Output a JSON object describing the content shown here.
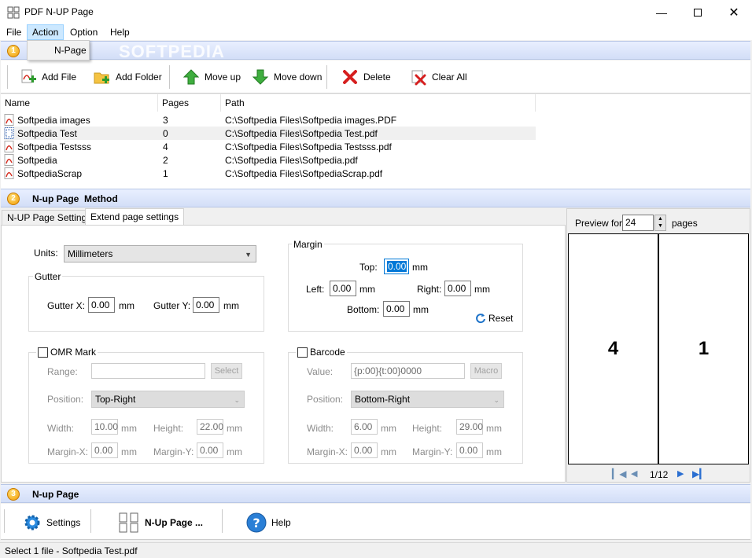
{
  "window": {
    "title": "PDF N-UP Page",
    "controls": [
      "minimize",
      "maximize",
      "close"
    ]
  },
  "menu": {
    "items": [
      "File",
      "Action",
      "Option",
      "Help"
    ],
    "active": "Action",
    "dropdown": [
      "N-Page"
    ]
  },
  "watermark": "SOFTPEDIA",
  "sections": [
    {
      "num": "1",
      "title": ""
    },
    {
      "num": "2",
      "title": "N-up Page  Method"
    },
    {
      "num": "3",
      "title": "N-up Page"
    }
  ],
  "toolbar": {
    "add_file": "Add File",
    "add_folder": "Add Folder",
    "move_up": "Move up",
    "move_down": "Move down",
    "delete": "Delete",
    "clear_all": "Clear All"
  },
  "filelist": {
    "columns": [
      "Name",
      "Pages",
      "Path"
    ],
    "rows": [
      {
        "name": "Softpedia images",
        "pages": "3",
        "path": "C:\\Softpedia Files\\Softpedia images.PDF"
      },
      {
        "name": "Softpedia Test",
        "pages": "0",
        "path": "C:\\Softpedia Files\\Softpedia Test.pdf"
      },
      {
        "name": "Softpedia Testsss",
        "pages": "4",
        "path": "C:\\Softpedia Files\\Softpedia Testsss.pdf"
      },
      {
        "name": "Softpedia",
        "pages": "2",
        "path": "C:\\Softpedia Files\\Softpedia.pdf"
      },
      {
        "name": "SoftpediaScrap",
        "pages": "1",
        "path": "C:\\Softpedia Files\\SoftpediaScrap.pdf"
      }
    ]
  },
  "tabs": [
    "N-UP Page Settings",
    "Extend page settings"
  ],
  "settings": {
    "units_label": "Units:",
    "units_value": "Millimeters",
    "gutter_title": "Gutter",
    "gutter_x_label": "Gutter X:",
    "gutter_x_value": "0.00",
    "gutter_y_label": "Gutter Y:",
    "gutter_y_value": "0.00",
    "mm": "mm",
    "margin_title": "Margin",
    "top_label": "Top:",
    "top_value": "0.00",
    "left_label": "Left:",
    "left_value": "0.00",
    "right_label": "Right:",
    "right_value": "0.00",
    "bottom_label": "Bottom:",
    "bottom_value": "0.00",
    "reset": "Reset",
    "omr_label": "OMR Mark",
    "omr_range_label": "Range:",
    "omr_select": "Select",
    "omr_position_label": "Position:",
    "omr_position_value": "Top-Right",
    "omr_width_label": "Width:",
    "omr_width_value": "10.00",
    "omr_height_label": "Height:",
    "omr_height_value": "22.00",
    "omr_marginx_label": "Margin-X:",
    "omr_marginx_value": "0.00",
    "omr_marginy_label": "Margin-Y:",
    "omr_marginy_value": "0.00",
    "barcode_label": "Barcode",
    "barcode_value_label": "Value:",
    "barcode_value": "{p:00}{t:00}0000",
    "barcode_macro": "Macro",
    "barcode_position_label": "Position:",
    "barcode_position_value": "Bottom-Right",
    "barcode_width_label": "Width:",
    "barcode_width_value": "6.00",
    "barcode_height_label": "Height:",
    "barcode_height_value": "29.00",
    "barcode_marginx_label": "Margin-X:",
    "barcode_marginx_value": "0.00",
    "barcode_marginy_label": "Margin-Y:",
    "barcode_marginy_value": "0.00"
  },
  "preview": {
    "label": "Preview for",
    "value": "24",
    "suffix": "pages",
    "page_left": "4",
    "page_right": "1",
    "page_indicator": "1/12"
  },
  "bottom_toolbar": {
    "settings": "Settings",
    "nup_page": "N-Up Page ...",
    "help": "Help"
  },
  "status": "Select 1 file - Softpedia Test.pdf",
  "colors": {
    "accent": "#0078d7",
    "section_badge": "#f29a00",
    "pdf_red": "#d42b1e"
  }
}
